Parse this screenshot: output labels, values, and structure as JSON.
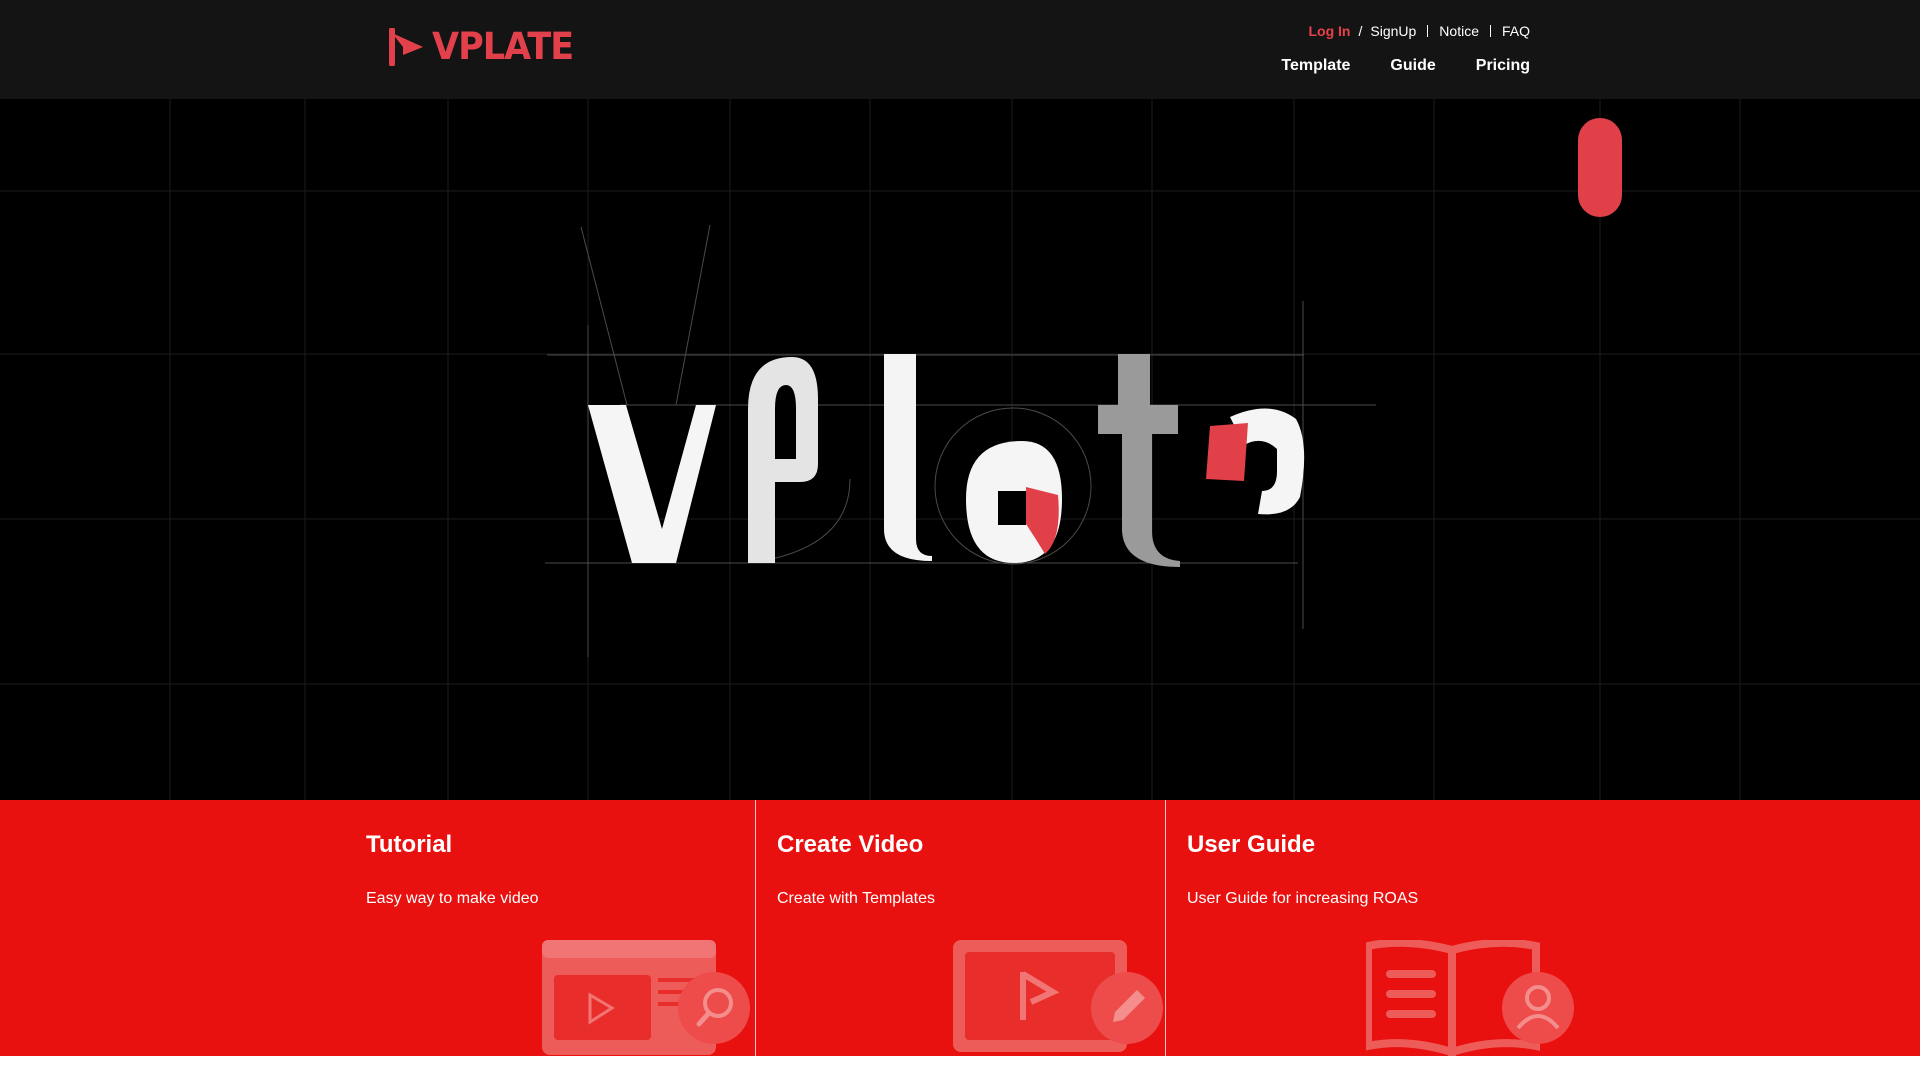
{
  "header": {
    "logo_text": "VPLATE",
    "logo_icon": "play-flag-icon",
    "util_links": {
      "login": "Log In",
      "login_sep": "/",
      "signup": "SignUp",
      "notice": "Notice",
      "faq": "FAQ"
    },
    "nav": {
      "template": "Template",
      "guide": "Guide",
      "pricing": "Pricing"
    }
  },
  "hero": {
    "wordmark": "vplate",
    "scroll_indicator": "scroll-pill"
  },
  "features": [
    {
      "title": "Tutorial",
      "description": "Easy way to make video",
      "icon": "video-search-icon"
    },
    {
      "title": "Create Video",
      "description": "Create with Templates",
      "icon": "video-edit-icon"
    },
    {
      "title": "User Guide",
      "description": "User Guide for increasing ROAS",
      "icon": "book-user-icon"
    }
  ],
  "colors": {
    "header_bg": "#141414",
    "hero_bg": "#000000",
    "brand_red": "#e2414b",
    "feature_bg": "#e8110f"
  }
}
